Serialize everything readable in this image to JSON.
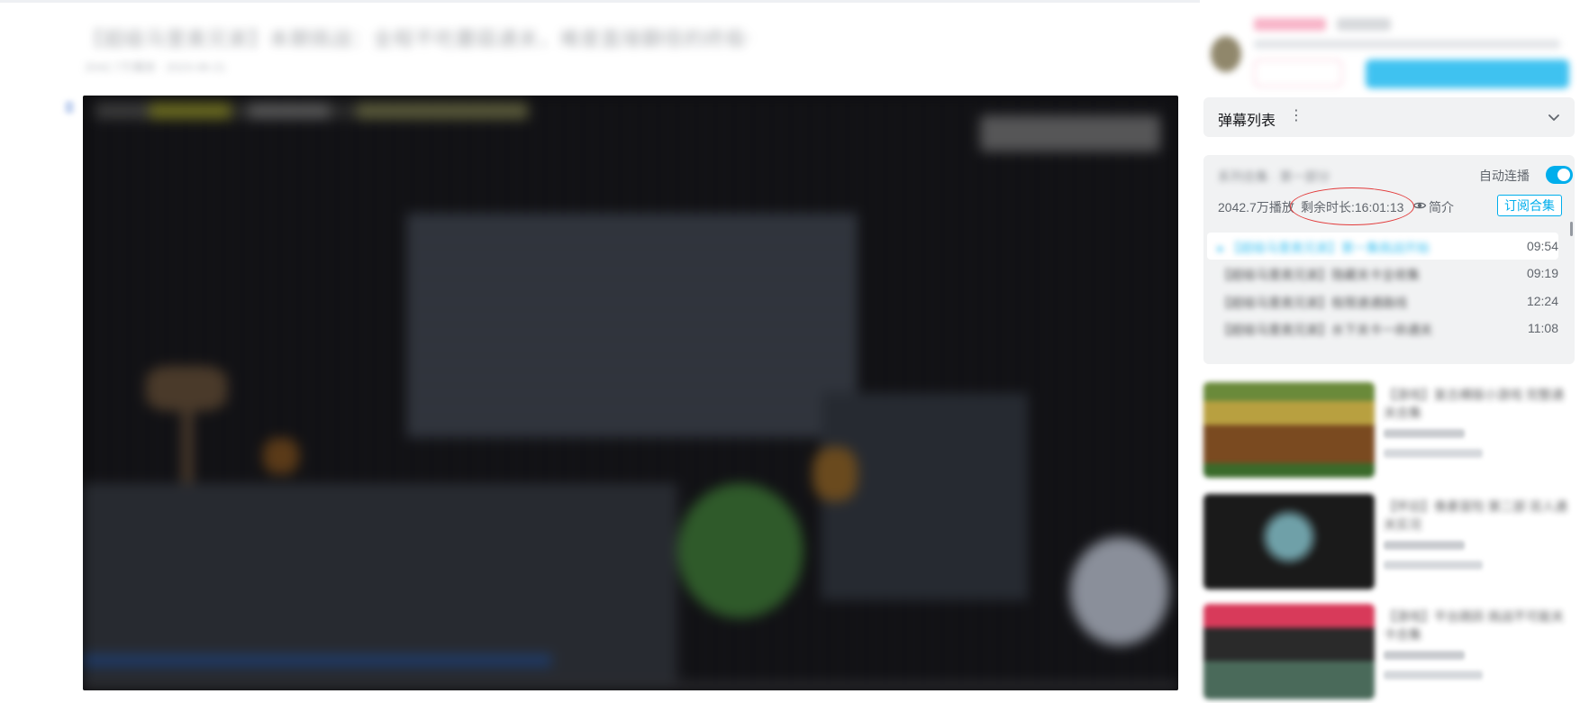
{
  "video": {
    "title": "【超级马里奥兄弟】本期挑战：全程不吃蘑菇通关，难度直接翻倍的终极考验",
    "meta": "2042.7万播放 · 2023-08-21"
  },
  "sidebar": {
    "danmaku_list_label": "弹幕列表",
    "more_icon_glyph": "⋮",
    "playlist": {
      "title": "系列合集 · 第一部分",
      "autoplay_label": "自动连播",
      "autoplay_on": true,
      "plays": "2042.7万播放",
      "remaining": "剩余时长:16:01:13",
      "intro_label": "简介",
      "subscribe_label": "订阅合集",
      "episodes": [
        {
          "title": "▸ 【超级马里奥兄弟】第一集挑战开始",
          "duration": "09:54",
          "active": true
        },
        {
          "title": "【超级马里奥兄弟】隐藏关卡全收集",
          "duration": "09:19",
          "active": false
        },
        {
          "title": "【超级马里奥兄弟】极限速通路线",
          "duration": "12:24",
          "active": false
        },
        {
          "title": "【超级马里奥兄弟】水下关卡一命通关",
          "duration": "11:08",
          "active": false
        }
      ]
    },
    "recommendations": [
      {
        "title": "【游戏】复古横版小游戏 完整通关合集",
        "up": "UP主",
        "stats": "12.3万 · 45"
      },
      {
        "title": "【怀旧】像素冒险 第二部 双人通关实况",
        "up": "UP主",
        "stats": "8.6万 · 27"
      },
      {
        "title": "【游戏】平台跳跃 挑战不可能关卡合集",
        "up": "UP主",
        "stats": "5.1万 · 18"
      }
    ]
  },
  "colors": {
    "accent": "#00aeec",
    "highlight": "#e23a3a",
    "panel_bg": "#f1f2f3"
  }
}
